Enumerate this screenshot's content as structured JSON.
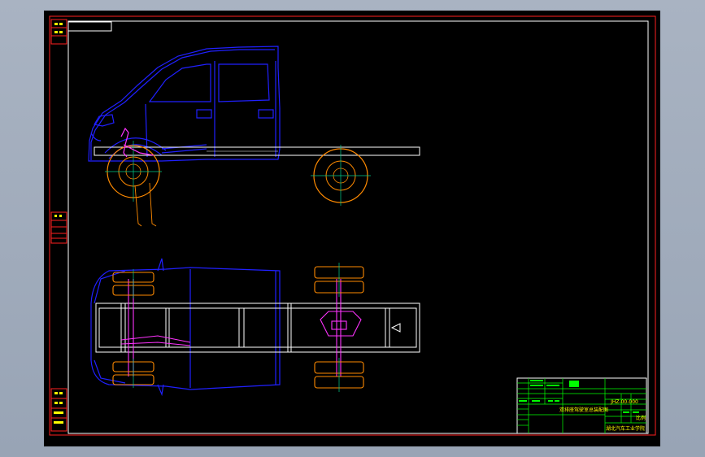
{
  "title_block": {
    "drawing_title": "双排座驾驶室总装配图",
    "drawing_number": "JHZ-00-000",
    "company": "湖北汽车工业学院",
    "scale_label": "比例",
    "scale_value": "1:10",
    "sheet_label": "第 张"
  },
  "colors": {
    "frame": "#ff0000",
    "cab": "#2020ff",
    "chassis_outline": "#ffffff",
    "wheel": "#ff8a00",
    "axle": "#ff33ff",
    "centerline": "#00cc88",
    "title_block": "#00ff00",
    "viewport_bg": "#000000"
  },
  "icons": {
    "side_view": "truck-side-view-drawing",
    "top_view": "truck-top-view-drawing"
  }
}
